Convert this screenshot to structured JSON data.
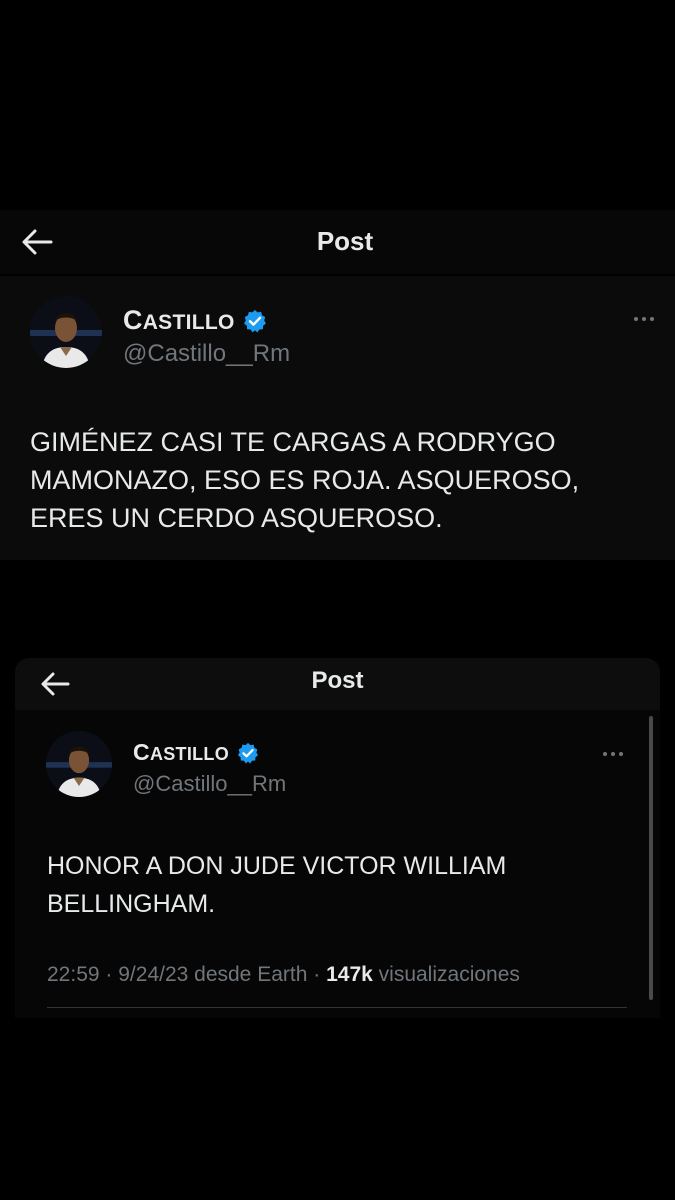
{
  "screen1": {
    "header": {
      "title": "Post"
    },
    "post": {
      "author": {
        "name_initial": "C",
        "name_rest": "ASTILLO",
        "handle": "@Castillo__Rm",
        "verified": true
      },
      "text": "GIMÉNEZ CASI TE CARGAS A RODRYGO MAMONAZO, ESO ES ROJA. ASQUEROSO, ERES UN CERDO ASQUEROSO."
    }
  },
  "screen2": {
    "header": {
      "title": "Post"
    },
    "post": {
      "author": {
        "name_initial": "C",
        "name_rest": "ASTILLO",
        "handle": "@Castillo__Rm",
        "verified": true
      },
      "text": "HONOR A DON JUDE VICTOR WILLIAM BELLINGHAM.",
      "meta": {
        "time": "22:59",
        "sep1": "·",
        "date_source": "9/24/23 desde Earth",
        "sep2": "·",
        "views_count": "147k",
        "views_label": "visualizaciones"
      }
    }
  },
  "icons": {
    "back": "arrow-left-icon",
    "verified": "verified-badge-icon",
    "more": "more-horizontal-icon"
  },
  "colors": {
    "background": "#000000",
    "text_primary": "#e7e9ea",
    "text_secondary": "#71767b",
    "verified_blue": "#1d9bf0"
  }
}
